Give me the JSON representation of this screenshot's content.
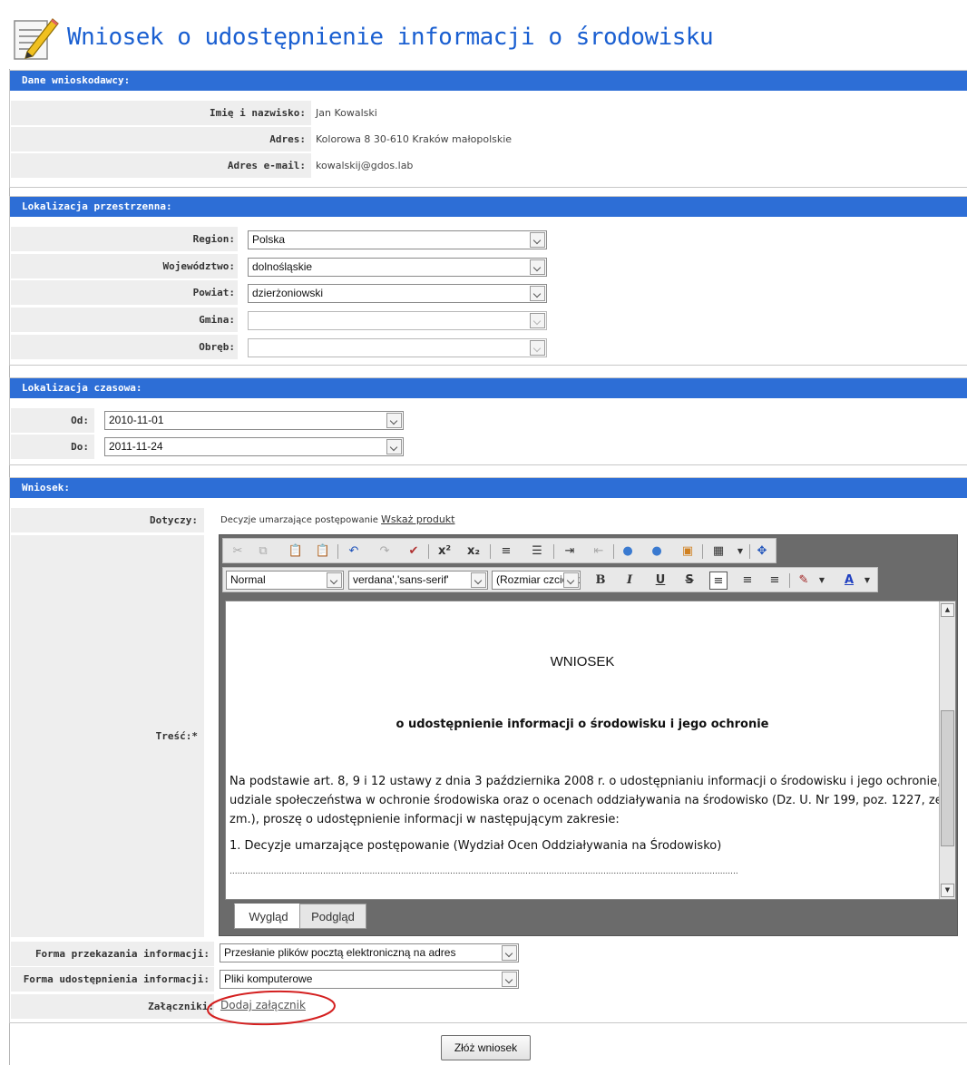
{
  "page_title": "Wniosek o udostępnienie informacji o środowisku",
  "sections": {
    "applicant": {
      "title": "Dane wnioskodawcy:",
      "name_label": "Imię i nazwisko:",
      "name_value": "Jan Kowalski",
      "address_label": "Adres:",
      "address_value": "Kolorowa 8 30-610 Kraków małopolskie",
      "email_label": "Adres e-mail:",
      "email_value": "kowalskij@gdos.lab"
    },
    "spatial": {
      "title": "Lokalizacja przestrzenna:",
      "region_label": "Region:",
      "region_value": "Polska",
      "voivodeship_label": "Województwo:",
      "voivodeship_value": "dolnośląskie",
      "county_label": "Powiat:",
      "county_value": "dzierżoniowski",
      "commune_label": "Gmina:",
      "commune_value": "",
      "precinct_label": "Obręb:",
      "precinct_value": ""
    },
    "temporal": {
      "title": "Lokalizacja czasowa:",
      "from_label": "Od:",
      "from_value": "2010-11-01",
      "to_label": "Do:",
      "to_value": "2011-11-24"
    },
    "request": {
      "title": "Wniosek:",
      "concerns_label": "Dotyczy:",
      "concerns_value": "Decyzje umarzające postępowanie",
      "concerns_link": "Wskaż produkt",
      "content_label": "Treść:*",
      "format_label": "Normal",
      "font_label": "verdana','sans-serif'",
      "size_label": "(Rozmiar czcionki)",
      "doc_heading": "WNIOSEK",
      "doc_subheading": "o udostępnienie informacji o środowisku i jego ochronie",
      "doc_body": "Na podstawie art. 8, 9 i 12 ustawy z dnia 3 października 2008 r. o udostępnianiu informacji o środowisku i jego ochronie, udziale społeczeństwa w ochronie środowiska oraz o ocenach oddziaływania na środowisko (Dz. U. Nr 199, poz. 1227, ze zm.), proszę o udostępnienie informacji w następującym zakresie:",
      "doc_item": "1. Decyzje umarzające postępowanie (Wydział Ocen Oddziaływania na Środowisko)",
      "doc_dots": "........................................................................................................................................................................................................................",
      "tab_design": "Wygląd",
      "tab_preview": "Podgląd",
      "delivery_label": "Forma przekazania informacji:",
      "delivery_value": "Przesłanie plików pocztą elektroniczną na adres",
      "sharing_label": "Forma udostępnienia informacji:",
      "sharing_value": "Pliki komputerowe",
      "attachments_label": "Załączniki:",
      "attachments_link": "Dodaj załącznik"
    }
  },
  "submit_label": "Złóż wniosek",
  "colors": {
    "header_blue": "#2d6ed6",
    "title_blue": "#1a5fd1",
    "row_gray": "#eeeeee",
    "highlight_red": "#d42020"
  }
}
